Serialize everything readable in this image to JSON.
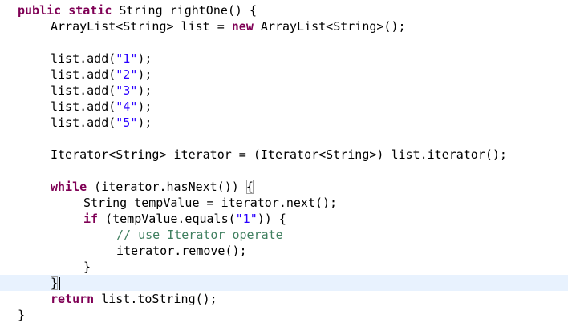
{
  "editor": {
    "current_line_index": 17,
    "colors": {
      "keyword": "#7f0055",
      "string": "#2a00ff",
      "comment": "#3f7f5f",
      "plain": "#000000",
      "current_line_bg": "#e8f2fe"
    },
    "lines": [
      {
        "indent": 0,
        "tokens": [
          {
            "k": "kw",
            "t": "public static"
          },
          {
            "k": "pl",
            "t": " String rightOne() {"
          }
        ]
      },
      {
        "indent": 1,
        "tokens": [
          {
            "k": "pl",
            "t": "ArrayList<String> list = "
          },
          {
            "k": "kw",
            "t": "new"
          },
          {
            "k": "pl",
            "t": " ArrayList<String>();"
          }
        ]
      },
      {
        "indent": 1,
        "tokens": []
      },
      {
        "indent": 1,
        "tokens": [
          {
            "k": "pl",
            "t": "list.add("
          },
          {
            "k": "str",
            "t": "\"1\""
          },
          {
            "k": "pl",
            "t": ");"
          }
        ]
      },
      {
        "indent": 1,
        "tokens": [
          {
            "k": "pl",
            "t": "list.add("
          },
          {
            "k": "str",
            "t": "\"2\""
          },
          {
            "k": "pl",
            "t": ");"
          }
        ]
      },
      {
        "indent": 1,
        "tokens": [
          {
            "k": "pl",
            "t": "list.add("
          },
          {
            "k": "str",
            "t": "\"3\""
          },
          {
            "k": "pl",
            "t": ");"
          }
        ]
      },
      {
        "indent": 1,
        "tokens": [
          {
            "k": "pl",
            "t": "list.add("
          },
          {
            "k": "str",
            "t": "\"4\""
          },
          {
            "k": "pl",
            "t": ");"
          }
        ]
      },
      {
        "indent": 1,
        "tokens": [
          {
            "k": "pl",
            "t": "list.add("
          },
          {
            "k": "str",
            "t": "\"5\""
          },
          {
            "k": "pl",
            "t": ");"
          }
        ]
      },
      {
        "indent": 1,
        "tokens": []
      },
      {
        "indent": 1,
        "tokens": [
          {
            "k": "pl",
            "t": "Iterator<String> iterator = (Iterator<String>) list.iterator();"
          }
        ]
      },
      {
        "indent": 1,
        "tokens": []
      },
      {
        "indent": 1,
        "tokens": [
          {
            "k": "kw",
            "t": "while"
          },
          {
            "k": "pl",
            "t": " (iterator.hasNext()) "
          },
          {
            "k": "pl",
            "t": "{",
            "match": true
          }
        ]
      },
      {
        "indent": 2,
        "tokens": [
          {
            "k": "pl",
            "t": "String tempValue = iterator.next();"
          }
        ]
      },
      {
        "indent": 2,
        "tokens": [
          {
            "k": "kw",
            "t": "if"
          },
          {
            "k": "pl",
            "t": " (tempValue.equals("
          },
          {
            "k": "str",
            "t": "\"1\""
          },
          {
            "k": "pl",
            "t": ")) {"
          }
        ]
      },
      {
        "indent": 3,
        "tokens": [
          {
            "k": "cm",
            "t": "// use Iterator operate"
          }
        ]
      },
      {
        "indent": 3,
        "tokens": [
          {
            "k": "pl",
            "t": "iterator.remove();"
          }
        ]
      },
      {
        "indent": 2,
        "tokens": [
          {
            "k": "pl",
            "t": "}"
          }
        ]
      },
      {
        "indent": 1,
        "tokens": [
          {
            "k": "pl",
            "t": "}",
            "match": true,
            "caret": true
          }
        ]
      },
      {
        "indent": 1,
        "tokens": [
          {
            "k": "kw",
            "t": "return"
          },
          {
            "k": "pl",
            "t": " list.toString();"
          }
        ]
      },
      {
        "indent": 0,
        "tokens": [
          {
            "k": "pl",
            "t": "}"
          }
        ]
      }
    ]
  }
}
